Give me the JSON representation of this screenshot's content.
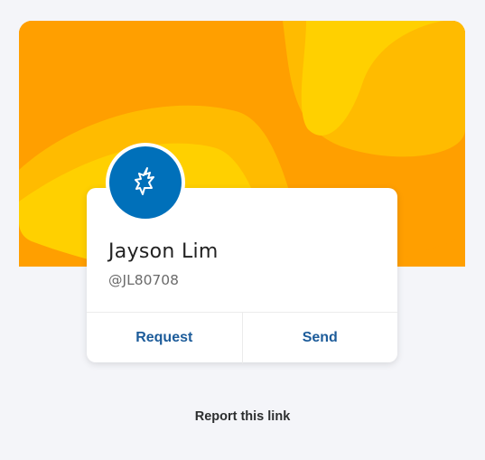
{
  "profile": {
    "name": "Jayson Lim",
    "handle": "@JL80708"
  },
  "actions": {
    "request_label": "Request",
    "send_label": "Send"
  },
  "footer": {
    "report_label": "Report this link"
  },
  "colors": {
    "background": "#f4f5f9",
    "banner_dark": "#ff9f00",
    "banner_mid": "#ffbb00",
    "banner_light": "#ffd000",
    "avatar": "#0070ba",
    "action_text": "#1d5c9a"
  },
  "icons": {
    "avatar": "bird-icon"
  }
}
